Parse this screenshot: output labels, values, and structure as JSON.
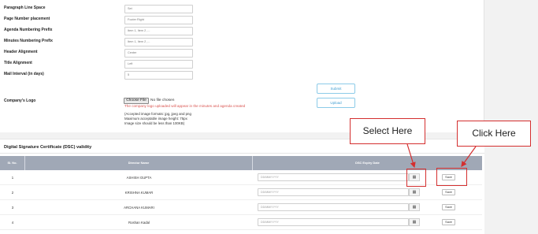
{
  "settings": {
    "rows": [
      {
        "label": "Paragraph Line Space",
        "value": "Set"
      },
      {
        "label": "Page Number placement",
        "value": "Footer Right"
      },
      {
        "label": "Agenda Numbering Prefix",
        "value": "Item 1, Item 2 ,..."
      },
      {
        "label": "Minutes Numbering Prefix",
        "value": "Item 1, Item 2 ,..."
      },
      {
        "label": "Header Alignment",
        "value": "Center"
      },
      {
        "label": "Title Alignment",
        "value": "Left"
      },
      {
        "label": "Mail Interval (in days)",
        "value": "5"
      }
    ],
    "submit_label": "Submit",
    "upload_label": "Upload"
  },
  "logo": {
    "label": "Company's Logo",
    "choose_file_label": "Choose File",
    "no_file_text": "No file chosen",
    "warning": "The company logo uploaded will appear in the minutes and agenda created",
    "notes": [
      "(Accepted image formats: jpg, jpeg and png",
      "Maximum acceptable image height: 75px",
      "Image size should be less than 100KB)"
    ]
  },
  "dsc": {
    "title": "Digital Signature Certificate (DSC) validity",
    "columns": [
      "Sl. No.",
      "Director Name",
      "DSC Expiry Date"
    ],
    "date_placeholder": "DD/MM/YYYY",
    "save_label": "Save",
    "rows": [
      {
        "sl": "1",
        "name": "ASHISH GUPTA"
      },
      {
        "sl": "2",
        "name": "KRISHNA KUMAR"
      },
      {
        "sl": "3",
        "name": "ARCHANA KUMARI"
      },
      {
        "sl": "4",
        "name": "Roshan Kadal"
      }
    ]
  },
  "annotations": {
    "select_here": "Select Here",
    "click_here": "Click Here",
    "color": "#d42f2f"
  },
  "colors": {
    "table_header": "#a0a8b6",
    "link_blue": "#3f9dd1",
    "warning_red": "#d9534f"
  }
}
